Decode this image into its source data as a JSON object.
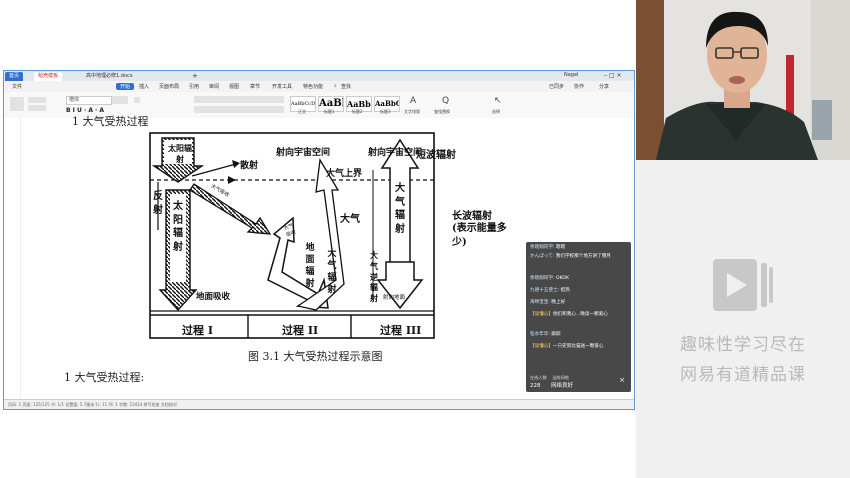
{
  "tabs": {
    "home": "首页",
    "template": "稻壳模板",
    "doc": "高中地理必修1.docx",
    "add": "+",
    "user": "Nagel"
  },
  "menu": [
    "文件",
    "开始",
    "插入",
    "页面布局",
    "引用",
    "审阅",
    "视图",
    "章节",
    "开发工具",
    "特色功能"
  ],
  "menu_search": "查找",
  "menu_right": [
    "已同步",
    "协作",
    "分享"
  ],
  "toolbar": {
    "font": "楷体",
    "styles": [
      "AaBbCcDd",
      "AaBb",
      "AaBbC",
      "AaBbC"
    ],
    "style_labels": [
      "正文",
      "标题1",
      "标题2",
      "标题3"
    ],
    "tools": [
      "文字排版",
      "查找替换",
      "选择"
    ],
    "tool_icons": [
      "A",
      "Q",
      "↖"
    ]
  },
  "document": {
    "top_line": "1 大气受热过程",
    "figure_caption": "图 3.1  大气受热过程示意图",
    "subheading": "1 大气受热过程:"
  },
  "diagram": {
    "sun": "太阳辐射",
    "scatter": "散射",
    "space_left": "射向宇宙空间",
    "space_right": "射向宇宙空间",
    "upper_boundary": "大气上界",
    "atmosphere": "大气",
    "reflection": "反射",
    "atmo_absorb": "大气吸收",
    "solar_rad": "太阳辐射",
    "ground_absorb": "地面吸收",
    "atmo_absorb2": "大气吸收",
    "ground_rad": "地面辐射",
    "atmo_rad": "大气辐射",
    "counter_rad": "大气逆辐射",
    "to_ground": "射向地面",
    "legend_short": "短波辐射",
    "legend_long": "长波辐射",
    "legend_long_note": "(表示能量多少)",
    "process1": "过程 I",
    "process2": "过程 II",
    "process3": "过程 III"
  },
  "chat": {
    "messages": [
      {
        "name": "余晓翔同学",
        "text": "嗯嗯"
      },
      {
        "name": "かんぱって",
        "text": "我们学校那个地方讲了哦月"
      },
      {
        "name": "余晓翔同学",
        "text": "OKOK"
      },
      {
        "name": "九德十五使士",
        "text": "挺热"
      },
      {
        "name": "海绵宝宝",
        "text": "晚上好"
      },
      {
        "name": "【读懂心】",
        "text": "他们和我心...晚读一颗爱心",
        "gold": true
      },
      {
        "name": "铅水年华",
        "text": "跟踪"
      },
      {
        "name": "【读懂心】",
        "text": "一只史努比猫送一颗爱心",
        "gold": true
      }
    ],
    "online_label": "在线人数",
    "online_count": "228",
    "net_label": "当前网络",
    "net_status": "网络良好",
    "close": "×"
  },
  "brand": {
    "line1": "趣味性学习尽在",
    "line2": "网易有道精品课"
  },
  "status": "页码: 1  页面: 125/125  节: 1/1  设置值: 5.7厘米  行: 11  列: 1  字数: 23414  拼写检查  文档校对"
}
